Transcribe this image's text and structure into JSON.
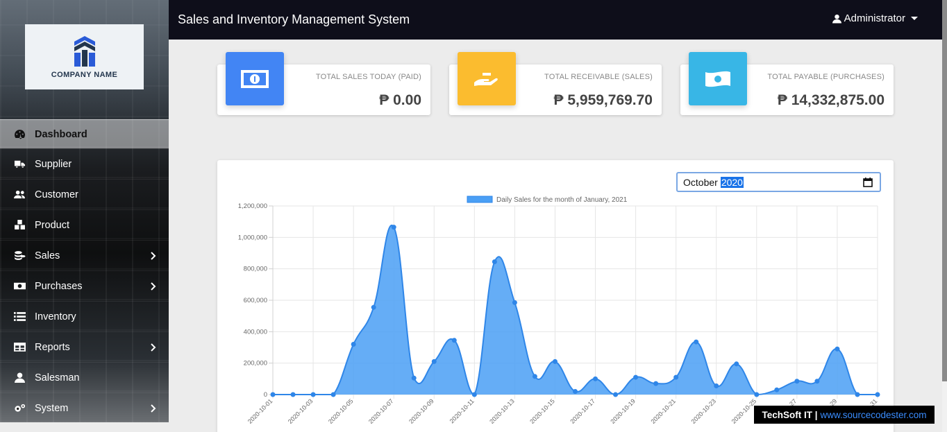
{
  "logo": {
    "text": "COMPANY NAME"
  },
  "sidebar": {
    "items": [
      {
        "label": "Dashboard",
        "icon": "dashboard-icon",
        "active": true,
        "submenu": false
      },
      {
        "label": "Supplier",
        "icon": "truck-icon",
        "submenu": false
      },
      {
        "label": "Customer",
        "icon": "users-icon",
        "submenu": false
      },
      {
        "label": "Product",
        "icon": "boxes-icon",
        "submenu": false
      },
      {
        "label": "Sales",
        "icon": "coins-icon",
        "submenu": true
      },
      {
        "label": "Purchases",
        "icon": "money-icon",
        "submenu": true
      },
      {
        "label": "Inventory",
        "icon": "list-icon",
        "submenu": false
      },
      {
        "label": "Reports",
        "icon": "table-icon",
        "submenu": true
      },
      {
        "label": "Salesman",
        "icon": "user-tie-icon",
        "submenu": false
      },
      {
        "label": "System",
        "icon": "cogs-icon",
        "submenu": true
      }
    ]
  },
  "header": {
    "title": "Sales and Inventory Management System",
    "user": "Administrator"
  },
  "cards": [
    {
      "label": "TOTAL SALES TODAY (PAID)",
      "value": "₱ 0.00",
      "color": "#4285f4",
      "icon": "money-bill-icon"
    },
    {
      "label": "TOTAL RECEIVABLE (SALES)",
      "value": "₱ 5,959,769.70",
      "color": "#fbbc2f",
      "icon": "hand-holding-icon"
    },
    {
      "label": "TOTAL PAYABLE (PURCHASES)",
      "value": "₱ 14,332,875.00",
      "color": "#38b6e6",
      "icon": "money-bill-wave-icon"
    }
  ],
  "month_picker": {
    "month": "October",
    "year": "2020"
  },
  "watermark": {
    "brand": "TechSoft IT |",
    "url": "www.sourcecodester.com"
  },
  "chart_data": {
    "type": "area",
    "legend": "Daily Sales for the month of January, 2021",
    "color": "#4a9ff5",
    "ylim": [
      0,
      1200000
    ],
    "yticks": [
      "0",
      "200,000",
      "400,000",
      "600,000",
      "800,000",
      "1,000,000",
      "1,200,000"
    ],
    "x": [
      "2020-10-01",
      "2020-10-02",
      "2020-10-03",
      "2020-10-04",
      "2020-10-05",
      "2020-10-06",
      "2020-10-07",
      "2020-10-08",
      "2020-10-09",
      "2020-10-10",
      "2020-10-11",
      "2020-10-12",
      "2020-10-13",
      "2020-10-14",
      "2020-10-15",
      "2020-10-16",
      "2020-10-17",
      "2020-10-18",
      "2020-10-19",
      "2020-10-20",
      "2020-10-21",
      "2020-10-22",
      "2020-10-23",
      "2020-10-24",
      "2020-10-25",
      "2020-10-26",
      "2020-10-27",
      "2020-10-28",
      "2020-10-29",
      "2020-10-30",
      "2020-10-31"
    ],
    "xtick_labels": [
      "2020-10-01",
      "2020-10-03",
      "2020-10-05",
      "2020-10-07",
      "2020-10-09",
      "2020-10-11",
      "2020-10-13",
      "2020-10-15",
      "2020-10-17",
      "2020-10-19",
      "2020-10-21",
      "2020-10-23",
      "2020-10-25",
      "-27",
      "-29",
      "-31"
    ],
    "values": [
      0,
      0,
      0,
      0,
      320000,
      555000,
      1065000,
      105000,
      210000,
      345000,
      0,
      845000,
      585000,
      115000,
      210000,
      20000,
      100000,
      0,
      110000,
      70000,
      110000,
      335000,
      55000,
      195000,
      0,
      30000,
      85000,
      85000,
      290000,
      0,
      0
    ]
  }
}
